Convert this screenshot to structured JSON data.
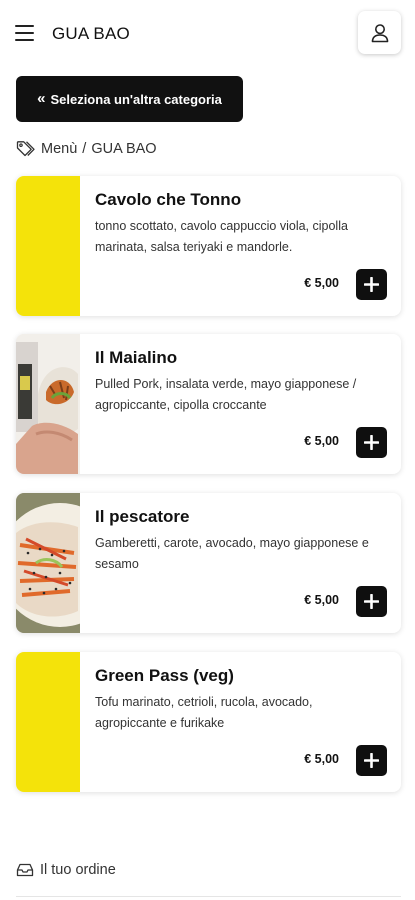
{
  "header": {
    "brand": "GUA BAO",
    "menu_icon": "hamburger-icon",
    "user_icon": "user-icon"
  },
  "back_button": {
    "icon": "double-chevron-left-icon",
    "label": "Seleziona un'altra categoria"
  },
  "breadcrumb": {
    "icon": "tag-icon",
    "root": "Menù",
    "separator": "/",
    "current": "GUA BAO"
  },
  "products": [
    {
      "name": "Cavolo che Tonno",
      "description": "tonno scottato, cavolo cappuccio viola, cipolla marinata, salsa teriyaki e mandorle.",
      "price": "€ 5,00",
      "image": "yellow-placeholder"
    },
    {
      "name": "Il Maialino",
      "description": "Pulled Pork, insalata verde, mayo giapponese / agropiccante, cipolla croccante",
      "price": "€ 5,00",
      "image": "bao-photo"
    },
    {
      "name": "Il pescatore",
      "description": "Gamberetti, carote, avocado, mayo giapponese e sesamo",
      "price": "€ 5,00",
      "image": "bao-photo"
    },
    {
      "name": "Green Pass (veg)",
      "description": "Tofu marinato, cetrioli, rucola, avocado, agropiccante e furikake",
      "price": "€ 5,00",
      "image": "yellow-placeholder"
    }
  ],
  "order": {
    "icon": "tray-icon",
    "label": "Il tuo ordine"
  },
  "colors": {
    "accent_yellow": "#f4e30a",
    "button_black": "#111111"
  }
}
